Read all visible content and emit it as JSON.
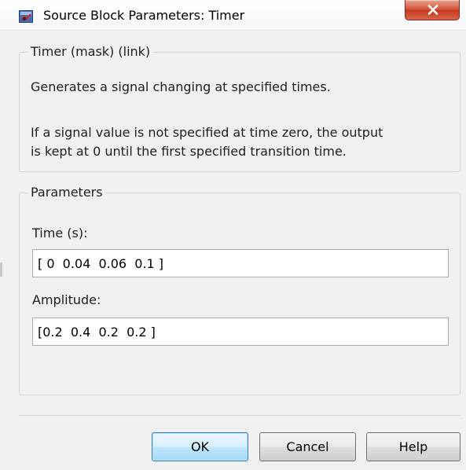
{
  "window": {
    "title": "Source Block Parameters: Timer",
    "icon": "simulink-block-icon",
    "close_icon": "close-x-icon"
  },
  "description_group": {
    "legend": "Timer (mask) (link)",
    "line1": "Generates a signal changing at specified times.",
    "line2": "If a signal value is not specified at time zero, the output",
    "line3": "is kept at 0 until the first specified transition time."
  },
  "parameters_group": {
    "legend": "Parameters",
    "time_label": "Time (s):",
    "time_value": "[ 0  0.04  0.06  0.1 ]",
    "amplitude_label": "Amplitude:",
    "amplitude_value": "[0.2  0.4  0.2  0.2 ]"
  },
  "buttons": {
    "ok": "OK",
    "cancel": "Cancel",
    "help": "Help"
  },
  "colors": {
    "close_button": "#c6381b",
    "default_button_border": "#3c7fb1",
    "dialog_background": "#f0f0f0"
  }
}
